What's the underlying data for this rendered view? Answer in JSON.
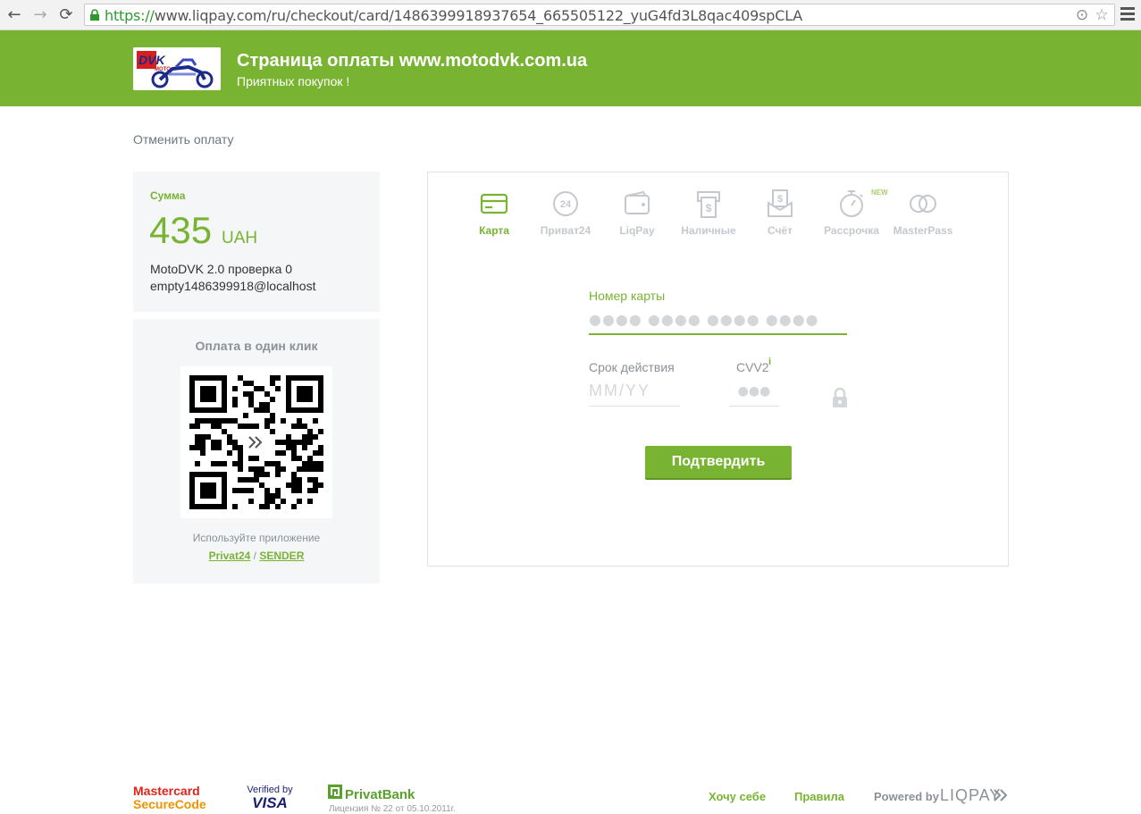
{
  "browser": {
    "back_icon": "←",
    "forward_icon": "→",
    "reload_icon": "⟳",
    "url_scheme": "https://",
    "url_rest": "www.liqpay.com/ru/checkout/card/1486399918937654_665505122_yuG4fd3L8qac409spCLA",
    "location_icon": "⊙",
    "star_icon": "☆"
  },
  "header": {
    "title": "Страница оплаты www.motodvk.com.ua",
    "subtitle": "Приятных покупок !",
    "logo_text": "DVK",
    "logo_sub": "MOTO"
  },
  "cancel_label": "Отменить оплату",
  "summary": {
    "sum_label": "Сумма",
    "amount": "435",
    "currency": "UAH",
    "description_line1": "MotoDVK 2.0 проверка 0",
    "description_line2": "empty1486399918@localhost"
  },
  "qr_panel": {
    "title": "Оплата в один клик",
    "hint": "Используйте приложение",
    "app1": "Privat24",
    "separator": " / ",
    "app2": "SENDER"
  },
  "tabs": [
    {
      "label": "Карта",
      "icon": "card-icon",
      "active": true
    },
    {
      "label": "Приват24",
      "icon": "privat24-icon",
      "active": false
    },
    {
      "label": "LiqPay",
      "icon": "wallet-icon",
      "active": false
    },
    {
      "label": "Наличные",
      "icon": "cash-terminal-icon",
      "active": false
    },
    {
      "label": "Счёт",
      "icon": "invoice-icon",
      "active": false
    },
    {
      "label": "Рассрочка",
      "icon": "stopwatch-icon",
      "active": false
    },
    {
      "label": "MasterPass",
      "icon": "masterpass-icon",
      "active": false
    }
  ],
  "new_badge": "NEW",
  "tab_icon_text": {
    "privat24": "24",
    "cash": "$",
    "invoice": "$"
  },
  "form": {
    "card_label": "Номер карты",
    "card_placeholder": "●●●● ●●●● ●●●● ●●●●",
    "card_value": "",
    "expiry_label": "Срок действия",
    "expiry_placeholder": "MM/YY",
    "cvv_label": "CVV2",
    "cvv_info": "i",
    "cvv_placeholder": "●●●",
    "confirm_label": "Подтвердить"
  },
  "footer": {
    "mastercard_line1": "Mastercard",
    "mastercard_line2": "SecureCode",
    "vbv_line1": "Verified by",
    "vbv_line2": "VISA",
    "privatbank": "PrivatBank",
    "license": "Лицензия № 22 от 05.10.2011г.",
    "link_want": "Хочу себе",
    "link_rules": "Правила",
    "powered": "Powered by",
    "liqpay": "LIQPAY"
  },
  "colors": {
    "brand_green": "#78b432",
    "muted_gray": "#8a9198",
    "panel_bg": "#f4f6f7"
  }
}
